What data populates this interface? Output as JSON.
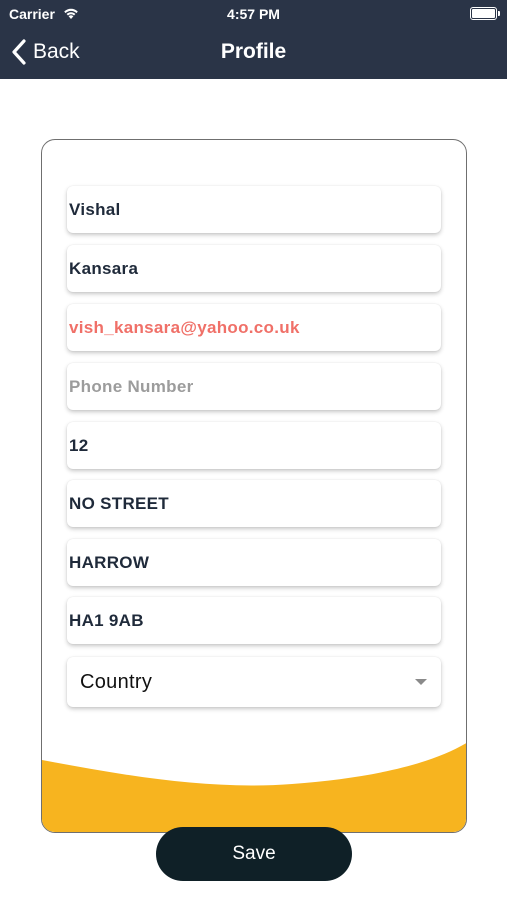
{
  "status_bar": {
    "carrier": "Carrier",
    "time": "4:57 PM"
  },
  "nav": {
    "back_label": "Back",
    "title": "Profile"
  },
  "form": {
    "first_name": "Vishal",
    "last_name": "Kansara",
    "email": "vish_kansara@yahoo.co.uk",
    "phone_placeholder": "Phone Number",
    "house_number": "12",
    "street": "NO STREET",
    "city": "HARROW",
    "postcode": "HA1 9AB",
    "country_placeholder": "Country"
  },
  "save_label": "Save",
  "colors": {
    "header": "#2a3447",
    "accent_wave": "#f7b41f",
    "save_button": "#0f2027",
    "email_text": "#f07068"
  }
}
